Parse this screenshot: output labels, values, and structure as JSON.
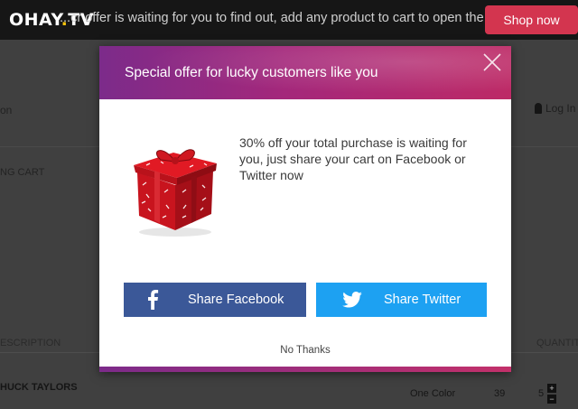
{
  "topbar": {
    "logo": "OHAY",
    "logo_dot": ".",
    "logo_tld": "TV",
    "message": "...cr offer is waiting for you to find out, add any product to cart to open the deal!",
    "cta": "Shop now"
  },
  "page": {
    "nav_left": "on",
    "login": "Log In",
    "breadcrumb": "NG CART",
    "table": {
      "col_description": "ESCRIPTION",
      "col_quantity": "QUANTITY"
    },
    "row": {
      "product": "HUCK TAYLORS",
      "color": "One Color",
      "price": "39",
      "quantity": "5",
      "plus": "+",
      "minus": "−"
    }
  },
  "modal": {
    "title": "Special offer for lucky customers like you",
    "offer_text": "30% off your total purchase is waiting for you, just share your cart on Facebook or Twitter now",
    "facebook_button": "Share Facebook",
    "twitter_button": "Share Twitter",
    "dismiss": "No Thanks"
  },
  "colors": {
    "facebook": "#3b5898",
    "twitter": "#1da1f2",
    "shop_now": "#d3354f",
    "header_gradient_start": "#7c2b8a",
    "header_gradient_end": "#bd2a66"
  },
  "icons": [
    "facebook-icon",
    "twitter-icon",
    "close-icon",
    "gift-box-icon",
    "user-icon"
  ]
}
